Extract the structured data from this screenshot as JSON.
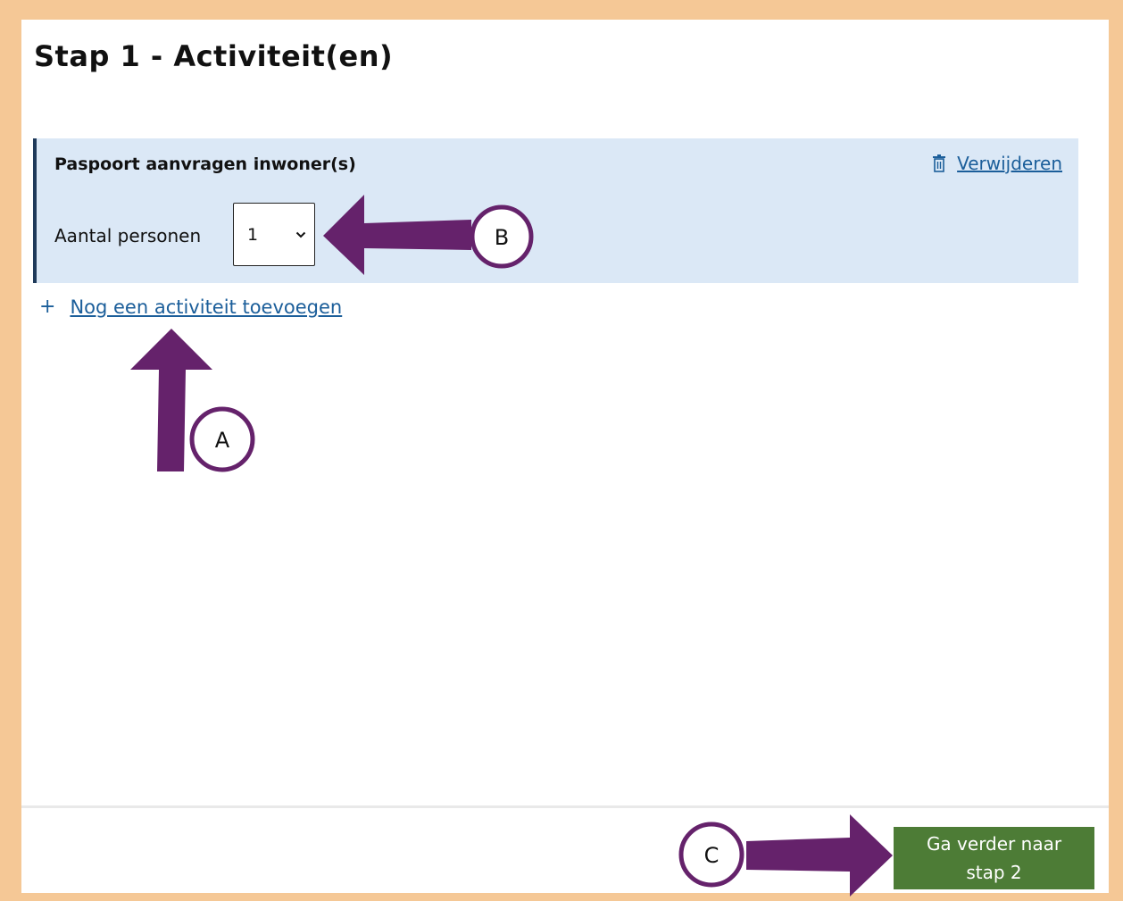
{
  "page": {
    "title": "Stap 1 - Activiteit(en)"
  },
  "activity": {
    "title": "Paspoort aanvragen inwoner(s)",
    "remove_label": "Verwijderen",
    "persons_label": "Aantal personen",
    "persons_value": "1"
  },
  "add_activity": {
    "label": "Nog een activiteit toevoegen",
    "icon": "+"
  },
  "footer": {
    "next_button_line1": "Ga verder naar",
    "next_button_line2": "stap 2"
  },
  "annotations": {
    "a": "A",
    "b": "B",
    "c": "C"
  },
  "colors": {
    "frame_border": "#f5c896",
    "card_bg": "#dbe8f6",
    "card_accent": "#1f3a5a",
    "link": "#1b5e9a",
    "primary_button": "#4d7c36",
    "annotation_purple": "#65226b"
  }
}
